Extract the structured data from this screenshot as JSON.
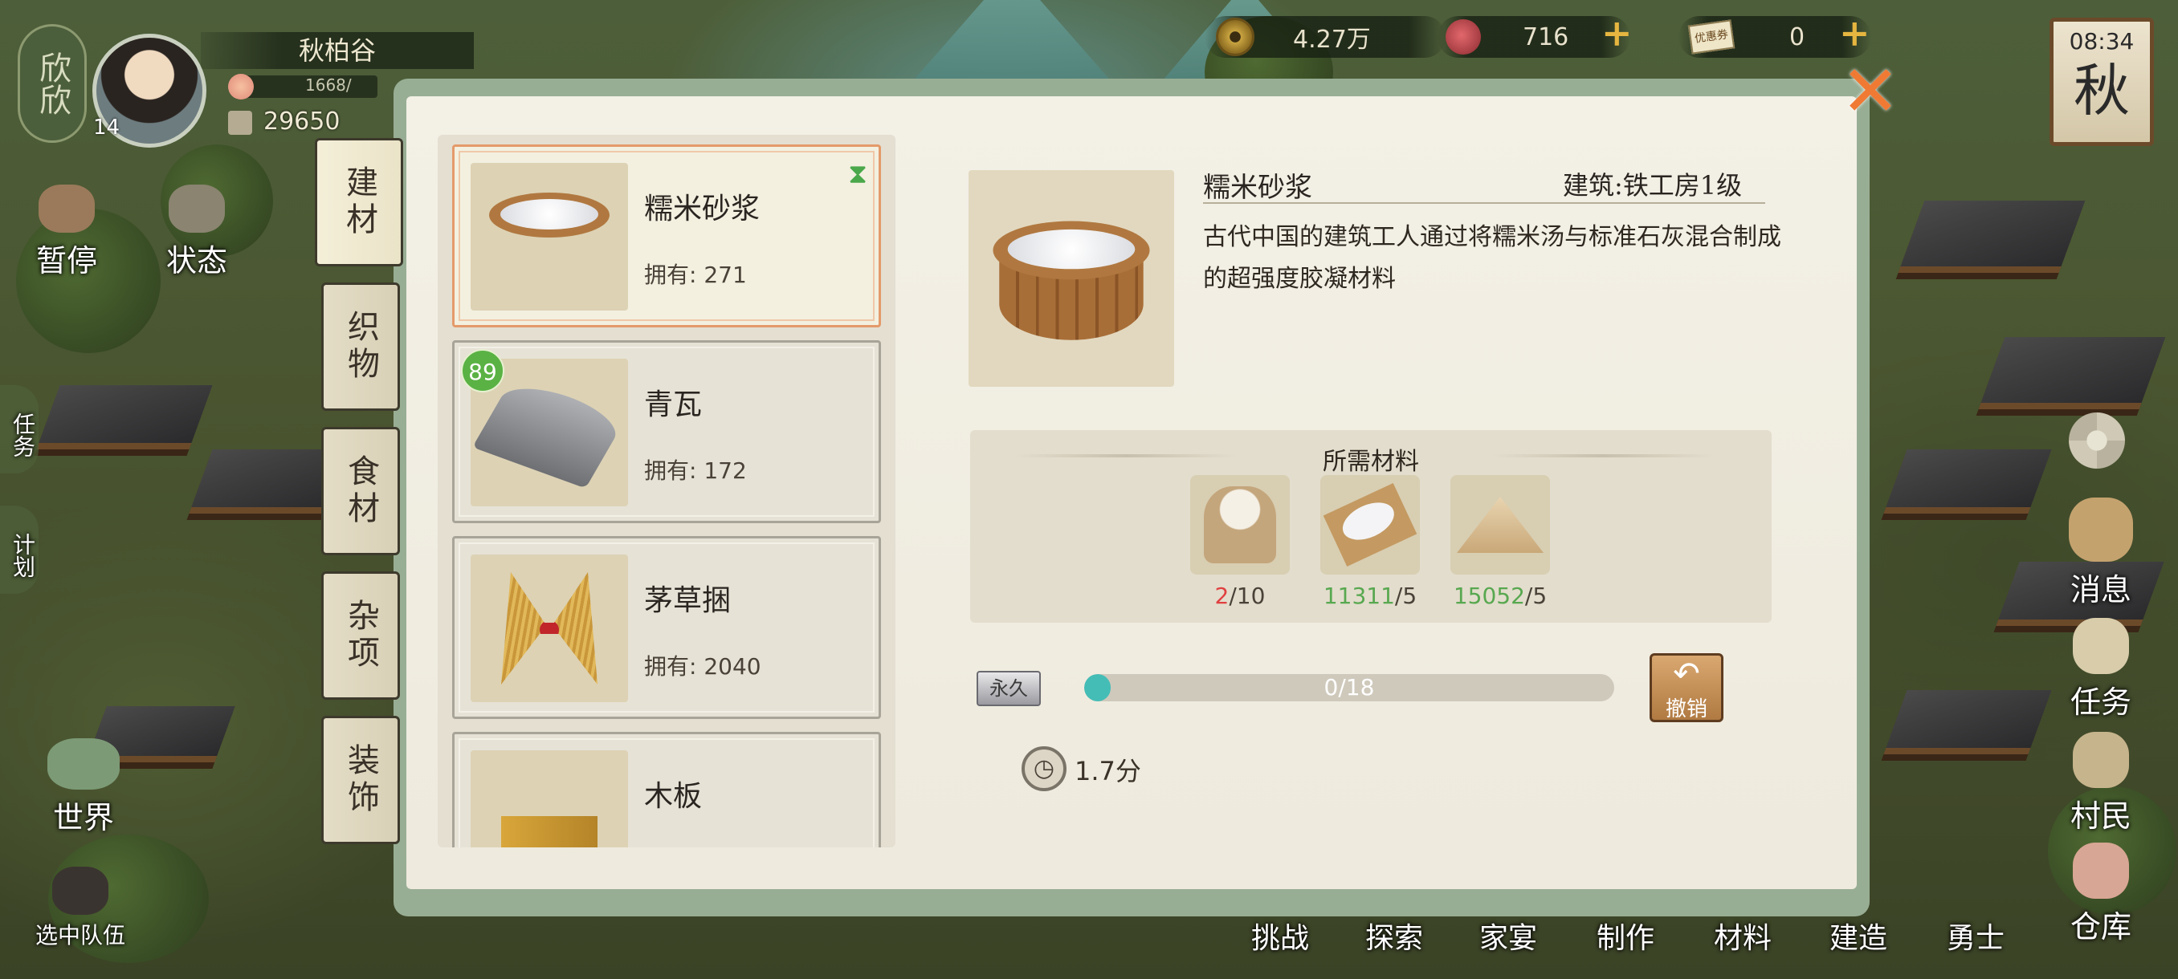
{
  "player": {
    "logo_text": "欣欣",
    "name": "秋柏谷",
    "level": "14",
    "exp_text": "1668/",
    "population": "29650"
  },
  "resources": {
    "coins": "4.27万",
    "roses": "716",
    "cards": "0",
    "card_icon_text": "优惠券"
  },
  "clock": {
    "time": "08:34",
    "season": "秋"
  },
  "left_buttons": [
    {
      "label": "暂停"
    },
    {
      "label": "状态"
    },
    {
      "label": "任务"
    },
    {
      "label": "计划"
    },
    {
      "label": "世界"
    },
    {
      "label": "选中队伍"
    }
  ],
  "right_buttons": [
    {
      "label": "消息"
    },
    {
      "label": "任务"
    },
    {
      "label": "村民"
    },
    {
      "label": "仓库"
    }
  ],
  "bottom_menu": [
    "挑战",
    "探索",
    "家宴",
    "制作",
    "材料",
    "建造",
    "勇士"
  ],
  "categories": [
    "建材",
    "织物",
    "食材",
    "杂项",
    "装饰"
  ],
  "items": [
    {
      "name": "糯米砂浆",
      "count": "拥有: 271",
      "icon": "mortar-bucket-icon"
    },
    {
      "name": "青瓦",
      "count": "拥有: 172",
      "badge": "89",
      "icon": "roof-tile-icon"
    },
    {
      "name": "茅草捆",
      "count": "拥有: 2040",
      "icon": "straw-bundle-icon"
    },
    {
      "name": "木板",
      "count": "",
      "icon": "wood-plank-icon"
    }
  ],
  "detail": {
    "title": "糯米砂浆",
    "building": "建筑:铁工房1级",
    "description": "古代中国的建筑工人通过将糯米汤与标准石灰混合制成的超强度胶凝材料",
    "materials_title": "所需材料",
    "materials": [
      {
        "icon": "rice-sack-icon",
        "have": "2",
        "need": "/10",
        "have_color": "#e04040"
      },
      {
        "icon": "flour-icon",
        "have": "11311",
        "need": "/5",
        "have_color": "#58a850"
      },
      {
        "icon": "lime-powder-icon",
        "have": "15052",
        "need": "/5",
        "have_color": "#58a850"
      }
    ],
    "permanent_label": "永久",
    "progress_text": "0/18",
    "progress_fraction": 0.05,
    "undo_label": "撤销",
    "time": "1.7分"
  },
  "colors": {
    "panel_frame": "#98ae94",
    "accent_orange": "#f07a34",
    "progress": "#44bdb6",
    "badge_green": "#5ab244"
  }
}
